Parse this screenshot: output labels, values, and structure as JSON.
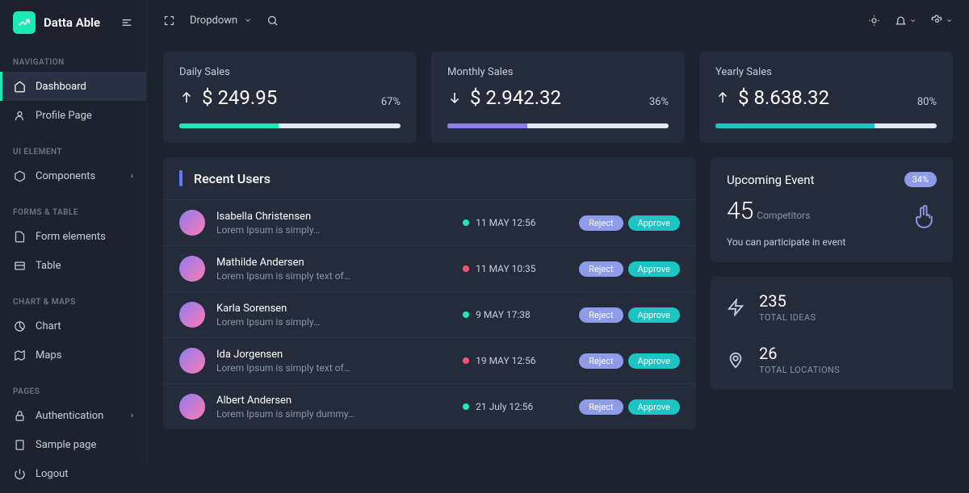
{
  "brand": {
    "name": "Datta Able"
  },
  "topbar": {
    "dropdown_label": "Dropdown"
  },
  "nav": {
    "s1_header": "NAVIGATION",
    "s1_items": [
      "Dashboard",
      "Profile Page"
    ],
    "s2_header": "UI ELEMENT",
    "s2_items": [
      "Components"
    ],
    "s3_header": "FORMS & TABLE",
    "s3_items": [
      "Form elements",
      "Table"
    ],
    "s4_header": "CHART & MAPS",
    "s4_items": [
      "Chart",
      "Maps"
    ],
    "s5_header": "PAGES",
    "s5_items": [
      "Authentication",
      "Sample page",
      "Logout"
    ]
  },
  "stats": [
    {
      "label": "Daily Sales",
      "value": "$ 249.95",
      "pct": "67%",
      "dir": "up",
      "color": "#1de9b6",
      "fill": 45
    },
    {
      "label": "Monthly Sales",
      "value": "$ 2.942.32",
      "pct": "36%",
      "dir": "down",
      "color": "#8e7cf0",
      "fill": 36
    },
    {
      "label": "Yearly Sales",
      "value": "$ 8.638.32",
      "pct": "80%",
      "dir": "up",
      "color": "#1dc4c4",
      "fill": 72
    }
  ],
  "users": {
    "title": "Recent Users",
    "reject_label": "Reject",
    "approve_label": "Approve",
    "rows": [
      {
        "name": "Isabella Christensen",
        "sub": "Lorem Ipsum is simply…",
        "date": "11 MAY 12:56",
        "status": "g"
      },
      {
        "name": "Mathilde Andersen",
        "sub": "Lorem Ipsum is simply text of…",
        "date": "11 MAY 10:35",
        "status": "r"
      },
      {
        "name": "Karla Sorensen",
        "sub": "Lorem Ipsum is simply…",
        "date": "9 MAY 17:38",
        "status": "g"
      },
      {
        "name": "Ida Jorgensen",
        "sub": "Lorem Ipsum is simply text of…",
        "date": "19 MAY 12:56",
        "status": "r"
      },
      {
        "name": "Albert Andersen",
        "sub": "Lorem Ipsum is simply dummy…",
        "date": "21 July 12:56",
        "status": "g"
      }
    ]
  },
  "event": {
    "title": "Upcoming Event",
    "pct": "34%",
    "big": "45",
    "label": "Competitors",
    "text": "You can participate in event"
  },
  "minis": [
    {
      "num": "235",
      "label": "TOTAL IDEAS"
    },
    {
      "num": "26",
      "label": "TOTAL LOCATIONS"
    }
  ]
}
